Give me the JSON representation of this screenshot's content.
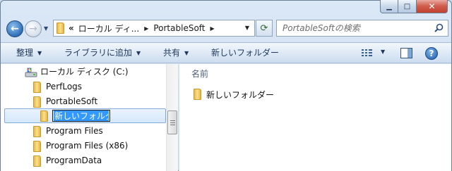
{
  "window": {
    "minimize_glyph": "▁",
    "maximize_glyph": "□",
    "close_glyph": "✕"
  },
  "nav": {
    "back_glyph": "←",
    "forward_glyph": "→",
    "recent_glyph": "▼"
  },
  "address": {
    "overflow": "«",
    "crumbs": [
      "ローカル ディ...",
      "PortableSoft"
    ],
    "separator": "▶",
    "dropdown_glyph": "▼",
    "refresh_glyph": "⟳"
  },
  "search": {
    "placeholder": "PortableSoftの検索"
  },
  "commandbar": {
    "organize": "整理",
    "library": "ライブラリに追加",
    "share": "共有",
    "new_folder": "新しいフォルダー",
    "help": "?"
  },
  "tree": {
    "drive": "ローカル ディスク (C:)",
    "items": [
      "PerfLogs",
      "PortableSoft"
    ],
    "rename_value": "新しいフォルダー",
    "items_after": [
      "Program Files",
      "Program Files (x86)",
      "ProgramData"
    ]
  },
  "content": {
    "column_name": "名前",
    "files": [
      "新しいフォルダー"
    ]
  },
  "colors": {
    "accent": "#3399ff",
    "command_text": "#1e395b"
  }
}
